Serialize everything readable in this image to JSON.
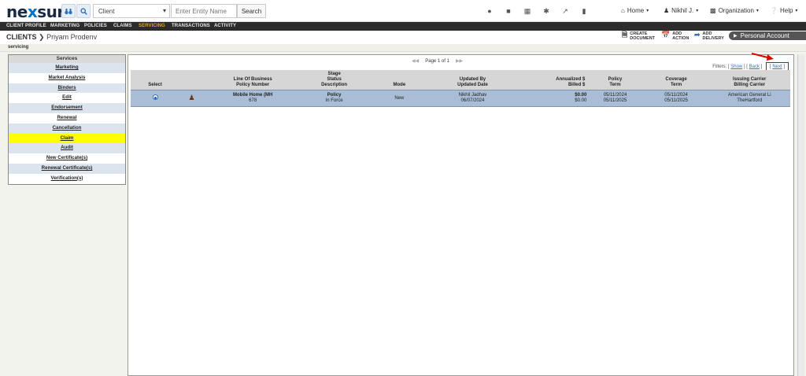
{
  "header": {
    "logo_pre": "ne",
    "logo_x": "x",
    "logo_post": "sure",
    "client_select_value": "Client",
    "entity_placeholder": "Enter Entity Name",
    "search_label": "Search",
    "home_label": "Home",
    "user_label": "Nikhil J.",
    "org_label": "Organization",
    "help_label": "Help"
  },
  "menu": {
    "items": [
      "CLIENT PROFILE",
      "MARKETING",
      "POLICIES",
      "CLAIMS",
      "SERVICING",
      "TRANSACTIONS",
      "ACTIVITY"
    ],
    "active": "SERVICING"
  },
  "page": {
    "crumb_prefix": "CLIENTS",
    "crumb_name": "Priyam Prodenv",
    "section": "servicing",
    "action_create": [
      "CREATE",
      "DOCUMENT"
    ],
    "action_add": [
      "ADD",
      "ACTION"
    ],
    "action_delivery": [
      "ADD",
      "DELIVERY"
    ],
    "personal_account": "Personal Account"
  },
  "sidebar": {
    "heading": "Services",
    "items": [
      "Marketing",
      "Market Analysis",
      "Binders",
      "Edit",
      "Endorsement",
      "Renewal",
      "Cancellation",
      "Claim",
      "Audit",
      "New Certificate(s)",
      "Renewal Certificate(s)",
      "Verification(s)"
    ],
    "highlighted": "Claim"
  },
  "pager": {
    "label": "Page 1 of 1"
  },
  "filters": {
    "label": "Filters:",
    "show": "Show",
    "back": "Back",
    "next": "Next"
  },
  "table": {
    "headers": [
      [
        "Select"
      ],
      [
        ""
      ],
      [
        "Line Of Business",
        "Policy Number"
      ],
      [
        "Stage",
        "Status",
        "Description"
      ],
      [
        "Mode"
      ],
      [
        "Updated By",
        "Updated Date"
      ],
      [
        "Annualized $",
        "Billed $"
      ],
      [
        "Policy",
        "Term"
      ],
      [
        "Coverage",
        "Term"
      ],
      [
        "Issuing Carrier",
        "Billing Carrier"
      ]
    ],
    "row": {
      "lob": "Mobile Home (MH",
      "policy_number": "678",
      "stage": "Policy",
      "status": "In Force",
      "mode": "New",
      "updated_by": "Nikhil Jadhav",
      "updated_date": "06/07/2024",
      "annualized": "$0.00",
      "billed": "$0.00",
      "policy_term_start": "05/11/2024",
      "policy_term_end": "05/11/2025",
      "coverage_term_start": "05/11/2024",
      "coverage_term_end": "05/11/2025",
      "issuing_carrier": "American General Li",
      "billing_carrier": "TheHartford"
    }
  },
  "colors": {
    "accent": "#0074c8",
    "menu_active": "#f0a500",
    "row_selected": "#a9bed6",
    "highlight": "#ffff00",
    "callout": "#e00000"
  }
}
